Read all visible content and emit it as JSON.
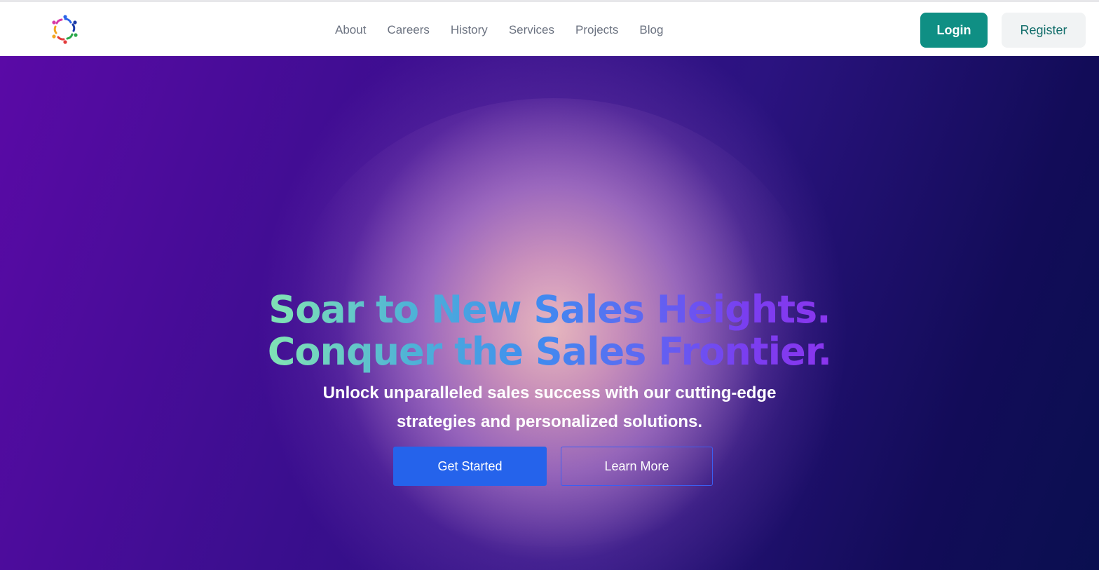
{
  "header": {
    "logo_icon": "colorful-people-circle-logo",
    "nav": [
      {
        "label": "About"
      },
      {
        "label": "Careers"
      },
      {
        "label": "History"
      },
      {
        "label": "Services"
      },
      {
        "label": "Projects"
      },
      {
        "label": "Blog"
      }
    ],
    "login_label": "Login",
    "register_label": "Register"
  },
  "hero": {
    "headline_line1": "Soar to New Sales Heights.",
    "headline_line2": "Conquer the Sales Frontier.",
    "subtitle_line1": "Unlock unparalleled sales success with our cutting-edge",
    "subtitle_line2": "strategies and personalized solutions.",
    "primary_cta": "Get Started",
    "secondary_cta": "Learn More"
  },
  "colors": {
    "login_bg": "#0f8f84",
    "register_text": "#116d6a",
    "primary_cta_bg": "#2563eb",
    "secondary_cta_border": "#3b5ff2",
    "hero_deep": "#3a0e8e"
  }
}
